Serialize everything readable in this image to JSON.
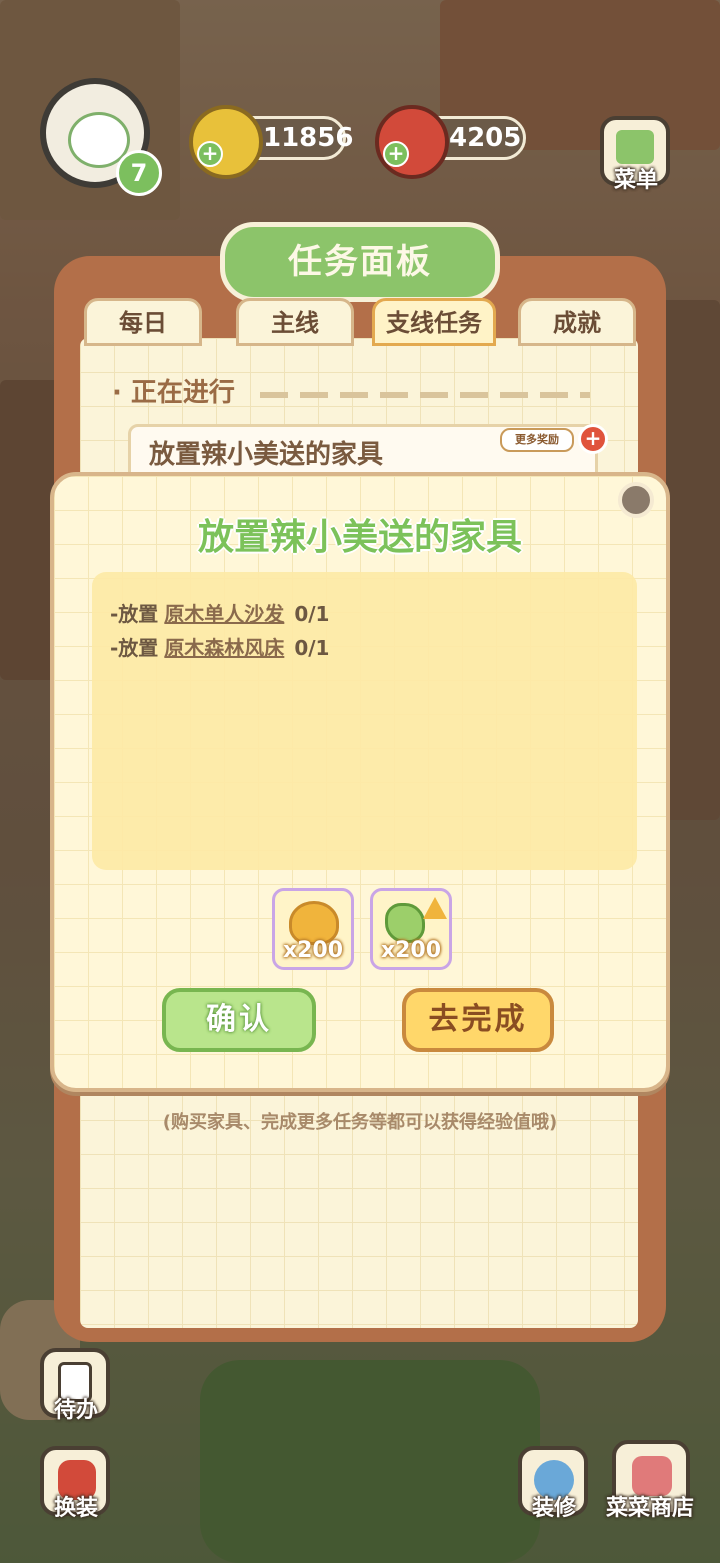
{
  "hud": {
    "level": "7",
    "coins": "11856",
    "food": "4205",
    "menu_label": "菜单"
  },
  "board": {
    "title": "任务面板",
    "tabs": [
      {
        "label": "每日",
        "active": false
      },
      {
        "label": "主线",
        "active": false
      },
      {
        "label": "支线任务",
        "active": true
      },
      {
        "label": "成就",
        "active": false
      }
    ],
    "section_label": "· 正在进行",
    "task_title": "放置辣小美送的家具",
    "more_rewards": "更多奖励",
    "footer_note": "(购买家具、完成更多任务等都可以获得经验值哦)"
  },
  "dialog": {
    "title": "放置辣小美送的家具",
    "requirements": [
      {
        "prefix": "-放置",
        "item": "原木单人沙发",
        "progress": "0/1"
      },
      {
        "prefix": "-放置",
        "item": "原木森林风床",
        "progress": "0/1"
      }
    ],
    "rewards": [
      {
        "icon": "coin-pile-icon",
        "count": "x200"
      },
      {
        "icon": "exp-up-icon",
        "count": "x200"
      }
    ],
    "confirm_label": "确认",
    "go_complete_label": "去完成"
  },
  "bottom_bar": {
    "todo_label": "待办",
    "dress_label": "换装",
    "decorate_label": "装修",
    "shop_label": "菜菜商店"
  },
  "colors": {
    "accent_green": "#7cc25a",
    "confirm_button": "#b9e58c",
    "go_button": "#ffd76a",
    "board_frame": "#b36f49"
  }
}
